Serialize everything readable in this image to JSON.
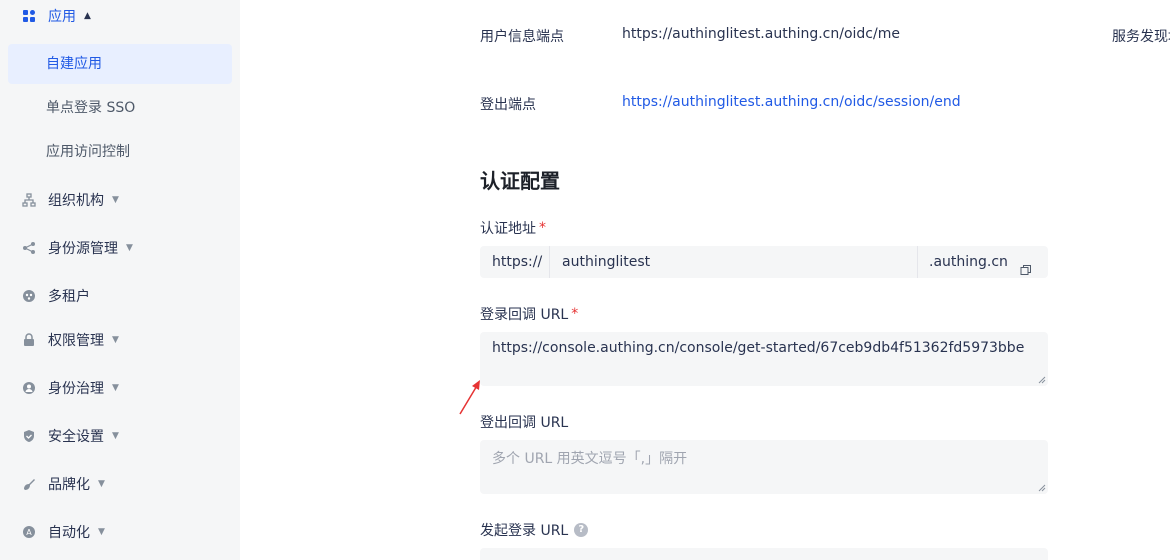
{
  "sidebar": {
    "app_group": "应用",
    "app_items": [
      {
        "label": "自建应用",
        "active": true
      },
      {
        "label": "单点登录 SSO",
        "active": false
      },
      {
        "label": "应用访问控制",
        "active": false
      }
    ],
    "groups": [
      {
        "label": "组织机构",
        "icon": "org-tree-icon"
      },
      {
        "label": "身份源管理",
        "icon": "share-nodes-icon"
      },
      {
        "label": "多租户",
        "icon": "tenant-icon"
      },
      {
        "label": "权限管理",
        "icon": "lock-icon"
      },
      {
        "label": "身份治理",
        "icon": "user-icon"
      },
      {
        "label": "安全设置",
        "icon": "shield-icon"
      },
      {
        "label": "品牌化",
        "icon": "brush-icon"
      },
      {
        "label": "自动化",
        "icon": "automation-icon"
      }
    ]
  },
  "endpoints": {
    "userinfo_label": "用户信息端点",
    "userinfo_value": "https://authinglitest.authing.cn/oidc/me",
    "discovery_label": "服务发现地",
    "logout_label": "登出端点",
    "logout_value": "https://authinglitest.authing.cn/oidc/session/end"
  },
  "auth_config": {
    "title": "认证配置",
    "auth_address_label": "认证地址",
    "protocol": "https://",
    "subdomain": "authinglitest",
    "domain_suffix": ".authing.cn",
    "callback_label": "登录回调 URL",
    "callback_value": "https://console.authing.cn/console/get-started/67ceb9db4f51362fd5973bbe",
    "logout_callback_label": "登出回调 URL",
    "logout_callback_placeholder": "多个 URL 用英文逗号「,」隔开",
    "initiate_login_label": "发起登录 URL"
  },
  "colors": {
    "accent": "#215ae5",
    "required": "#e63333",
    "sidebar_bg": "#f5f6f7"
  }
}
